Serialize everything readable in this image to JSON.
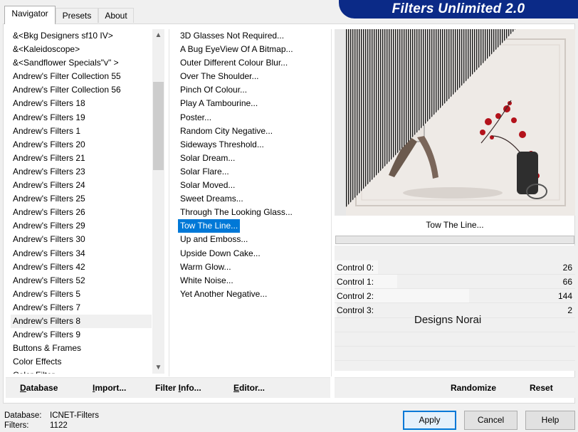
{
  "banner": {
    "title": "Filters Unlimited 2.0"
  },
  "tabs": [
    {
      "label": "Navigator",
      "active": true
    },
    {
      "label": "Presets",
      "active": false
    },
    {
      "label": "About",
      "active": false
    }
  ],
  "categories": {
    "items": [
      "&<Bkg Designers sf10 IV>",
      "&<Kaleidoscope>",
      "&<Sandflower Specials\"v\" >",
      "Andrew's Filter Collection 55",
      "Andrew's Filter Collection 56",
      "Andrew's Filters 18",
      "Andrew's Filters 19",
      "Andrew's Filters 1",
      "Andrew's Filters 20",
      "Andrew's Filters 21",
      "Andrew's Filters 23",
      "Andrew's Filters 24",
      "Andrew's Filters 25",
      "Andrew's Filters 26",
      "Andrew's Filters 29",
      "Andrew's Filters 30",
      "Andrew's Filters 34",
      "Andrew's Filters 42",
      "Andrew's Filters 52",
      "Andrew's Filters 5",
      "Andrew's Filters 7",
      "Andrew's Filters 8",
      "Andrew's Filters 9",
      "Buttons & Frames",
      "Color Effects",
      "Color Filter"
    ],
    "highlighted": "Andrew's Filters 8"
  },
  "filters": {
    "items": [
      "3D Glasses Not Required...",
      "A Bug EyeView Of A Bitmap...",
      "Outer Different Colour Blur...",
      "Over The Shoulder...",
      "Pinch Of Colour...",
      "Play A Tambourine...",
      "Poster...",
      "Random City Negative...",
      "Sideways Threshold...",
      "Solar Dream...",
      "Solar Flare...",
      "Solar Moved...",
      "Sweet Dreams...",
      "Through The Looking Glass...",
      "Tow The Line...",
      "Up and Emboss...",
      "Upside Down Cake...",
      "Warm Glow...",
      "White Noise...",
      "Yet Another Negative..."
    ],
    "selected": "Tow The Line..."
  },
  "preview": {
    "filter_name": "Tow The Line..."
  },
  "controls": [
    {
      "label": "Control 0:",
      "value": 26
    },
    {
      "label": "Control 1:",
      "value": 66
    },
    {
      "label": "Control 2:",
      "value": 144
    },
    {
      "label": "Control 3:",
      "value": 2
    }
  ],
  "credit": "Designs Norai",
  "toolbar": {
    "database": {
      "u": "D",
      "rest": "atabase"
    },
    "import": {
      "u": "I",
      "rest": "mport..."
    },
    "filter_info": {
      "pre": "Filter ",
      "u": "I",
      "rest": "nfo..."
    },
    "editor": {
      "u": "E",
      "rest": "ditor..."
    },
    "randomize": "Randomize",
    "reset": "Reset"
  },
  "footer": {
    "database_label": "Database:",
    "database_value": "ICNET-Filters",
    "filters_label": "Filters:",
    "filters_value": "1122"
  },
  "buttons": {
    "apply": "Apply",
    "cancel": "Cancel",
    "help": "Help"
  },
  "colors": {
    "banner": "#0b2a87",
    "selection": "#0078d7",
    "accent_default": "#0078d7"
  },
  "icons": {
    "scroll_up": "▲",
    "scroll_down": "▼"
  }
}
